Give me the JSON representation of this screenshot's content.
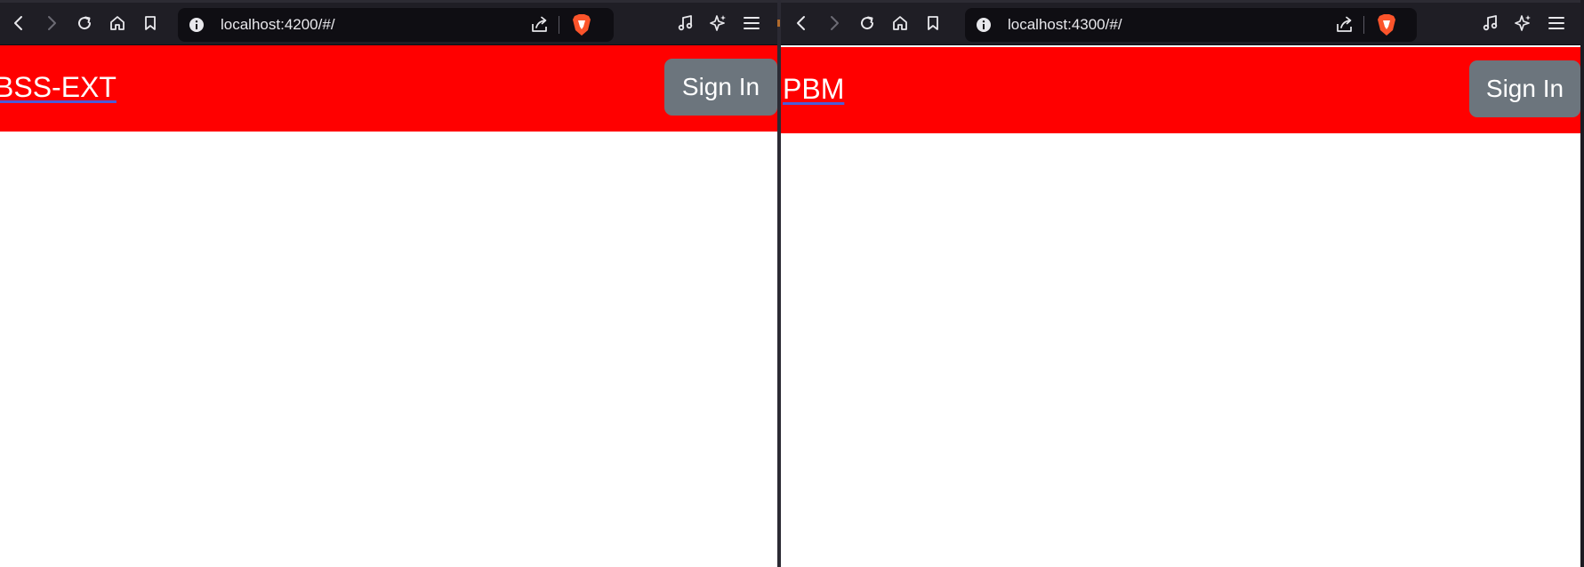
{
  "left_window": {
    "address_bar": {
      "url": "localhost:4200/#/"
    },
    "app": {
      "brand_label": "BSS-EXT",
      "sign_in_label": "Sign In",
      "header_color": "#ff0000"
    }
  },
  "right_window": {
    "address_bar": {
      "url": "localhost:4300/#/"
    },
    "app": {
      "brand_label": "PBM",
      "sign_in_label": "Sign In",
      "header_color": "#ff0000"
    }
  },
  "toolbar_icons": [
    "back-icon",
    "forward-icon",
    "reload-icon",
    "home-icon",
    "bookmark-icon",
    "site-info-icon",
    "share-icon",
    "brave-shields-icon",
    "media-icon",
    "leo-ai-icon",
    "menu-icon"
  ],
  "colors": {
    "toolbar_bg": "#1f1e25",
    "urlbar_bg": "#0f0e13",
    "button_gray": "#6c757d",
    "brave_orange": "#fb542b"
  }
}
